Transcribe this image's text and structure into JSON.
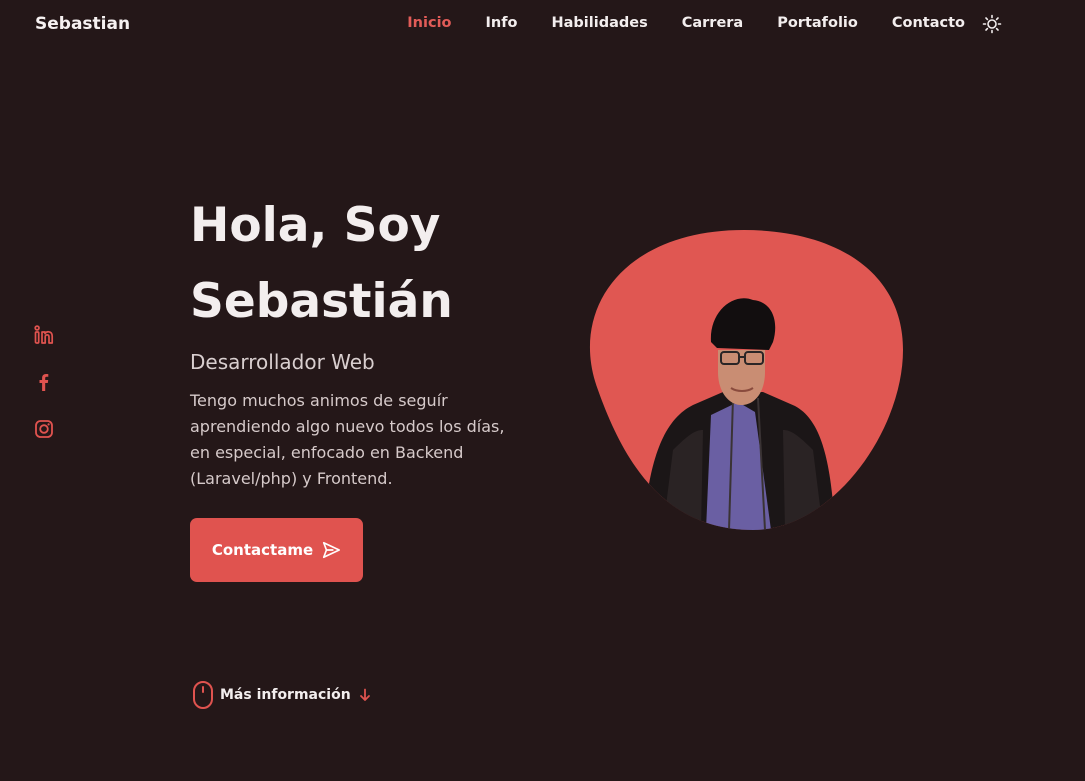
{
  "header": {
    "logo": "Sebastian",
    "nav": [
      {
        "label": "Inicio",
        "active": true
      },
      {
        "label": "Info",
        "active": false
      },
      {
        "label": "Habilidades",
        "active": false
      },
      {
        "label": "Carrera",
        "active": false
      },
      {
        "label": "Portafolio",
        "active": false
      },
      {
        "label": "Contacto",
        "active": false
      }
    ],
    "theme_icon": "sun-icon"
  },
  "social": [
    {
      "icon": "linkedin-icon"
    },
    {
      "icon": "facebook-icon"
    },
    {
      "icon": "instagram-icon"
    }
  ],
  "hero": {
    "title_line1": "Hola, Soy",
    "title_line2": "Sebastián",
    "subtitle": "Desarrollador Web",
    "description": "Tengo muchos animos de seguír aprendiendo algo nuevo todos los días, en especial, enfocado en Backend (Laravel/php) y Frontend.",
    "cta_label": "Contactame",
    "cta_icon": "send-icon"
  },
  "scroll": {
    "label": "Más información",
    "icon": "mouse-icon",
    "arrow_icon": "arrow-down-icon"
  },
  "colors": {
    "background": "#241718",
    "accent": "#e0534f",
    "text": "#f3eeee"
  }
}
